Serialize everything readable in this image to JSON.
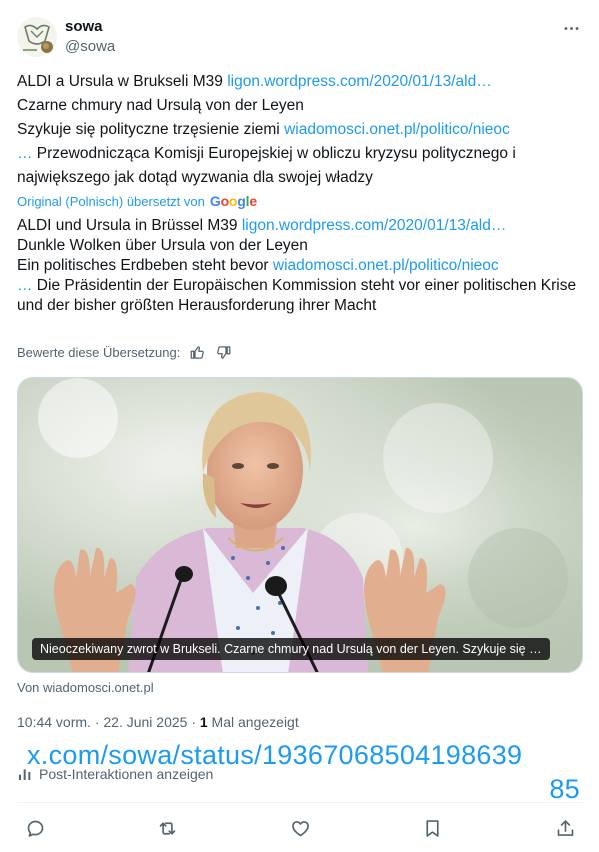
{
  "user": {
    "display_name": "sowa",
    "handle": "@sowa"
  },
  "original_text": {
    "line1_prefix": "ALDI a Ursula w Brukseli M39 ",
    "line1_link": "ligon.wordpress.com/2020/01/13/ald…",
    "line2": "Czarne chmury nad Ursulą von der Leyen",
    "line3_prefix": "Szykuje się polityczne trzęsienie ziemi ",
    "line3_link": "wiadomosci.onet.pl/politico/nieoc",
    "line4_link": "…",
    "line4_rest": " Przewodnicząca Komisji Europejskiej w obliczu  kryzysu politycznego i największego jak dotąd wyzwania dla swojej  władzy"
  },
  "translation": {
    "label": "Original (Polnisch) übersetzt von",
    "provider": "Google",
    "line1_prefix": "ALDI und Ursula in Brüssel M39 ",
    "line1_link": "ligon.wordpress.com/2020/01/13/ald…",
    "line2": "Dunkle Wolken über Ursula von der Leyen",
    "line3_prefix": "Ein politisches Erdbeben steht bevor ",
    "line3_link": "wiadomosci.onet.pl/politico/nieoc",
    "line4_link": "…",
    "line4_rest": " Die Präsidentin der Europäischen Kommission steht vor einer politischen Krise und der bisher größten Herausforderung ihrer Macht"
  },
  "rating": {
    "label": "Bewerte diese Übersetzung:",
    "up_icon": "thumbs-up-icon",
    "down_icon": "thumbs-down-icon"
  },
  "card": {
    "caption": "Nieoczekiwany zwrot w Brukseli. Czarne chmury nad Ursulą von der Leyen. Szykuje się …",
    "source": "Von wiadomosci.onet.pl"
  },
  "meta": {
    "time_date": "10:44 vorm. · 22. Juni 2025 · ",
    "views_count": "1",
    "views_label": " Mal angezeigt"
  },
  "status_url": {
    "line1": "x.com/sowa/status/19367068504198639",
    "line2": "85"
  },
  "analytics": {
    "label": "Post-Interaktionen anzeigen",
    "icon": "bar-chart-icon"
  },
  "actions": [
    "reply-icon",
    "repost-icon",
    "like-icon",
    "bookmark-icon",
    "share-icon"
  ],
  "colors": {
    "link": "#1d9bf0",
    "text": "#0f1419",
    "secondary": "#536471"
  }
}
